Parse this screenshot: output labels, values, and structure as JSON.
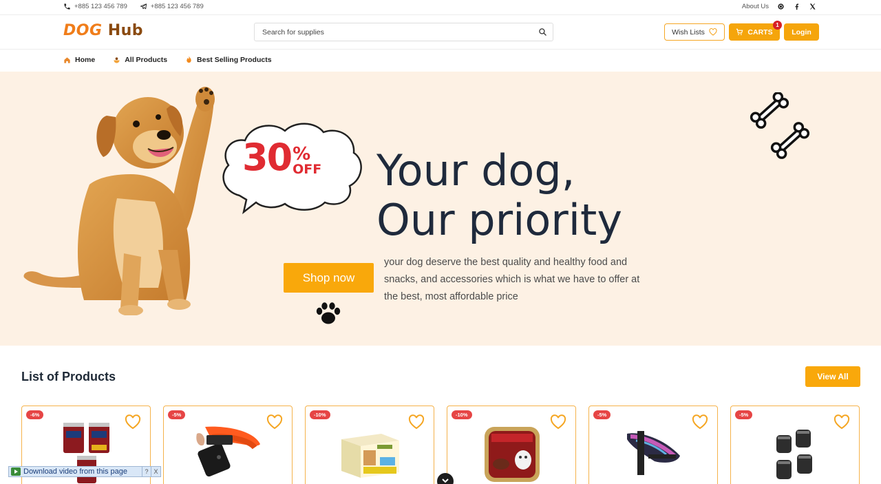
{
  "topbar": {
    "phone": "+885 123 456 789",
    "telegram": "+885 123 456 789",
    "about": "About Us",
    "icons": [
      "phone-icon",
      "telegram-icon",
      "instagram-icon",
      "facebook-icon",
      "x-icon"
    ]
  },
  "header": {
    "logo_a": "DOG",
    "logo_b": "Hub",
    "search_placeholder": "Search for supplies",
    "wish_label": "Wish Lists",
    "cart_label": "CARTS",
    "cart_count": "1",
    "login_label": "Login"
  },
  "nav": {
    "items": [
      {
        "label": "Home",
        "icon": "house-icon"
      },
      {
        "label": "All Products",
        "icon": "bowl-icon"
      },
      {
        "label": "Best Selling Products",
        "icon": "fire-icon"
      }
    ]
  },
  "hero": {
    "badge_number": "30",
    "badge_percent": "%",
    "badge_off": "OFF",
    "title_line1": "Your dog,",
    "title_line2": "Our priority",
    "description": "your dog deserve the best quality and healthy food and snacks, and accessories which is what we have to offer at the best, most affordable price",
    "cta": "Shop now"
  },
  "products": {
    "title": "List of Products",
    "view_all": "View All",
    "items": [
      {
        "discount": "-6%",
        "image": "dog-food-cans"
      },
      {
        "discount": "-5%",
        "image": "dog-collar"
      },
      {
        "discount": "-10%",
        "image": "treat-box"
      },
      {
        "discount": "-10%",
        "image": "food-tray"
      },
      {
        "discount": "-5%",
        "image": "dog-harness"
      },
      {
        "discount": "-5%",
        "image": "dog-boots"
      }
    ]
  },
  "overlay": {
    "download_label": "Download video from this page",
    "help": "?",
    "close": "X"
  },
  "colors": {
    "accent": "#f9a80b",
    "hero_bg": "#fdf1e4",
    "badge_red": "#e64545",
    "title_dark": "#1f2a3c"
  }
}
